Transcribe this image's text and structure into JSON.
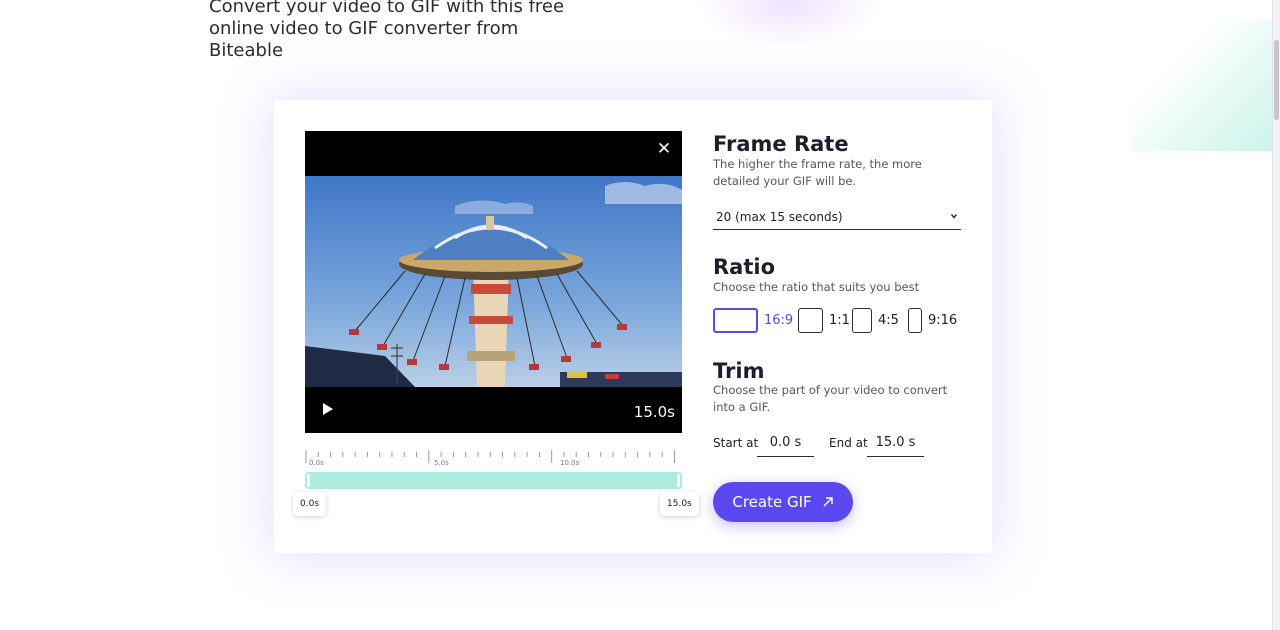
{
  "intro": {
    "text": "Convert your video to GIF with this free online video to GIF converter from Biteable"
  },
  "player": {
    "close_icon": "close-icon",
    "play_icon": "play-icon",
    "time_display": "15.0s"
  },
  "timeline": {
    "tick_labels": [
      "0.0s",
      "5.0s",
      "10.0s"
    ],
    "start_bubble": "0.0s",
    "end_bubble": "15.0s",
    "track_color": "#aeebdf"
  },
  "frame_rate": {
    "heading": "Frame Rate",
    "description": "The higher the frame rate, the more detailed your GIF will be.",
    "selected": "20 (max 15 seconds)",
    "chevron_icon": "chevron-down-icon"
  },
  "ratio": {
    "heading": "Ratio",
    "description": "Choose the ratio that suits you best",
    "options": [
      {
        "label": "16:9",
        "active": true
      },
      {
        "label": "1:1",
        "active": false
      },
      {
        "label": "4:5",
        "active": false
      },
      {
        "label": "9:16",
        "active": false
      }
    ],
    "active_color": "#5a4ae8"
  },
  "trim": {
    "heading": "Trim",
    "description": "Choose the part of your video to convert into a GIF.",
    "start_label": "Start at",
    "start_value": "0.0 s",
    "end_label": "End at",
    "end_value": "15.0 s"
  },
  "create": {
    "label": "Create GIF",
    "icon": "arrow-up-right-icon",
    "color": "#5b47f0"
  }
}
